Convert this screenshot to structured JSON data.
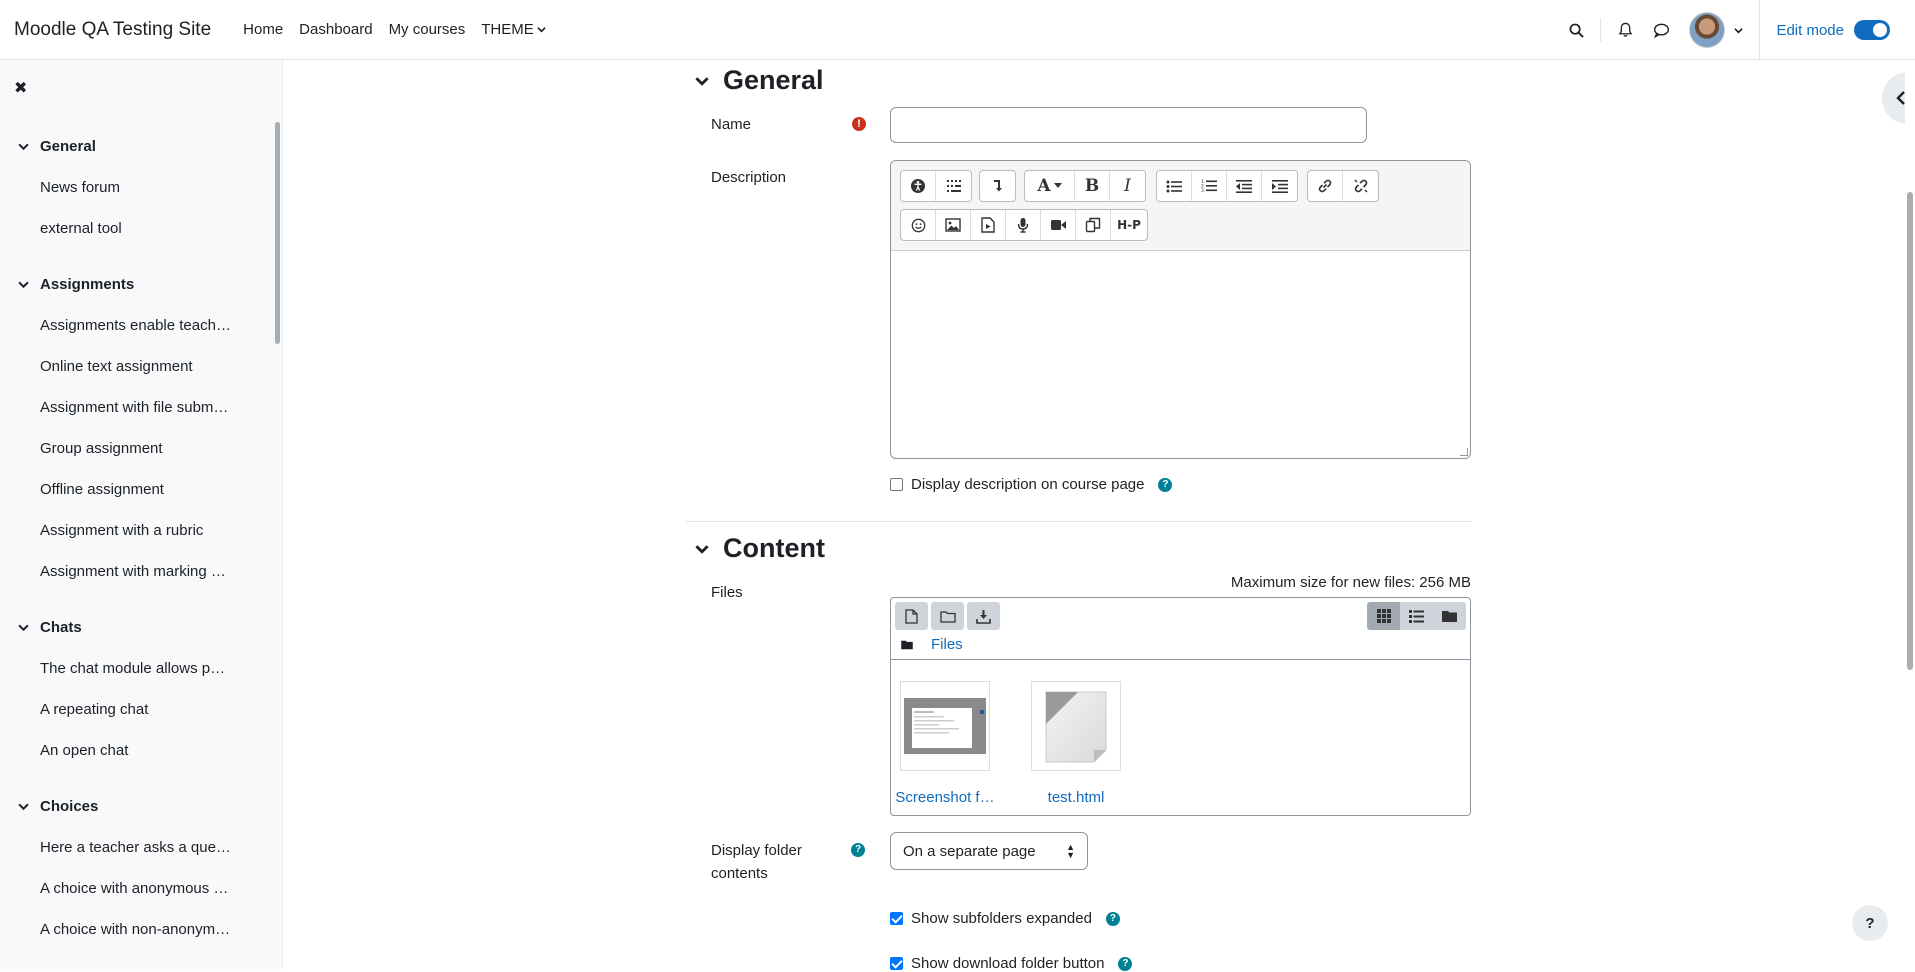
{
  "site": {
    "name": "Moodle QA Testing Site"
  },
  "nav": {
    "items": [
      {
        "label": "Home"
      },
      {
        "label": "Dashboard"
      },
      {
        "label": "My courses"
      }
    ],
    "theme_label": "THEME",
    "edit_mode_label": "Edit mode",
    "edit_mode_on": true
  },
  "drawer": {
    "sections": [
      {
        "title": "General",
        "items": [
          "News forum",
          "external tool"
        ]
      },
      {
        "title": "Assignments",
        "items": [
          "Assignments enable teach…",
          "Online text assignment",
          "Assignment with file subm…",
          "Group assignment",
          "Offline assignment",
          "Assignment with a rubric",
          "Assignment with marking …"
        ]
      },
      {
        "title": "Chats",
        "items": [
          "The chat module allows p…",
          "A repeating chat",
          "An open chat"
        ]
      },
      {
        "title": "Choices",
        "items": [
          "Here a teacher asks a que…",
          "A choice with anonymous …",
          "A choice with non-anonym…"
        ]
      }
    ]
  },
  "form": {
    "general": {
      "heading": "General",
      "name_label": "Name",
      "name_value": "",
      "description_label": "Description",
      "editor_h5p_label": "H-P",
      "display_description_label": "Display description on course page",
      "display_description_checked": false
    },
    "content": {
      "heading": "Content",
      "max_size_text": "Maximum size for new files: 256 MB",
      "files_label": "Files",
      "files_path_label": "Files",
      "files": [
        {
          "name": "Screenshot f…",
          "icon": "image-thumbnail"
        },
        {
          "name": "test.html",
          "icon": "generic-file-icon"
        }
      ],
      "display_folder_label": "Display folder contents",
      "display_folder_value": "On a separate page",
      "show_subfolders_label": "Show subfolders expanded",
      "show_subfolders_checked": true,
      "show_download_label": "Show download folder button",
      "show_download_checked": true
    }
  },
  "help_fab_label": "?",
  "colors": {
    "link": "#0f6cbf",
    "required": "#ca3120",
    "help": "#008196"
  }
}
